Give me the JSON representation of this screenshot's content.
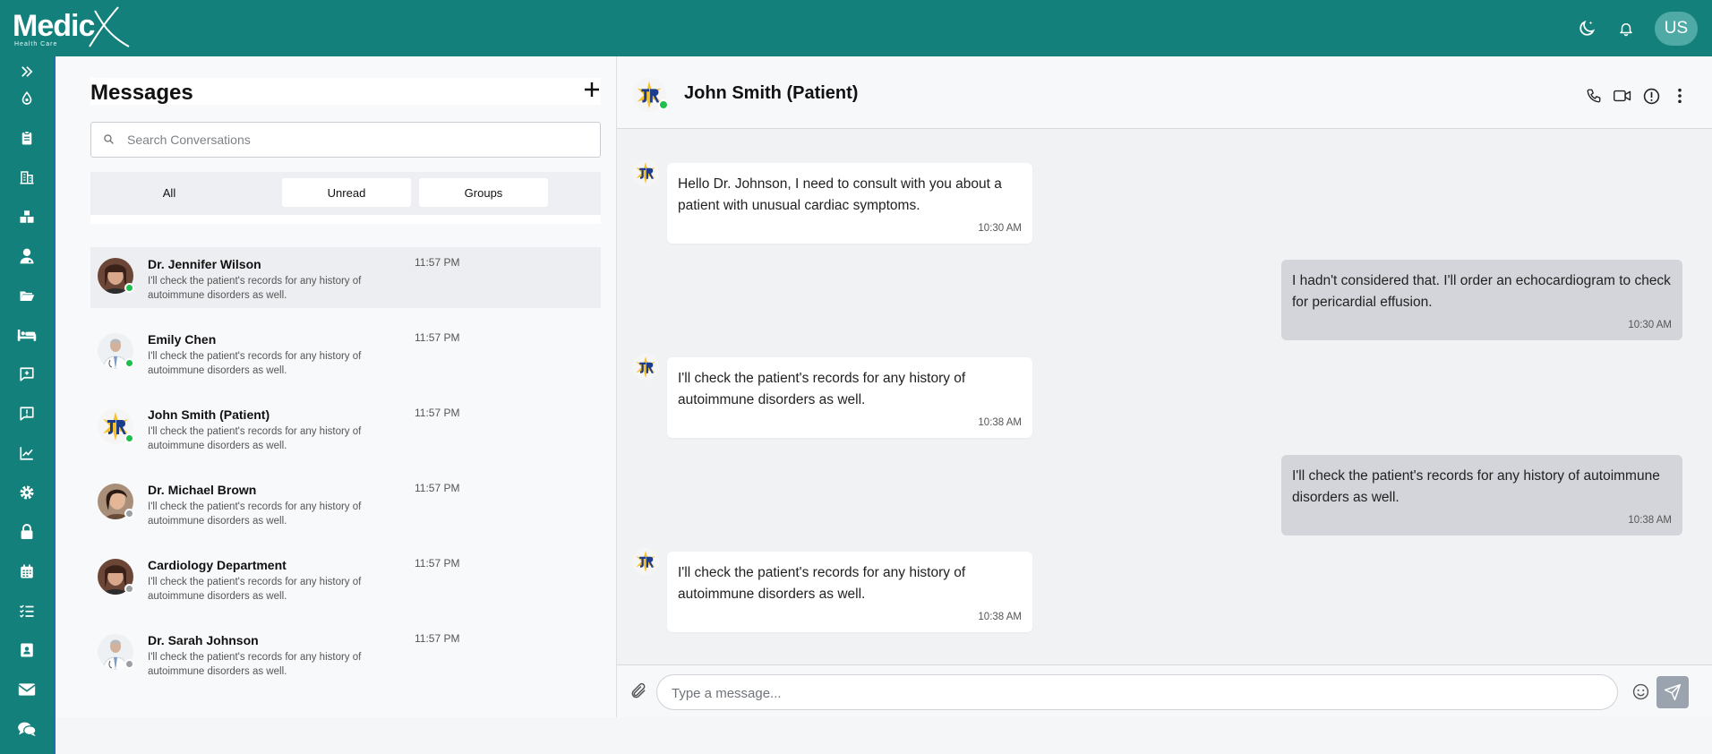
{
  "brand": {
    "name": "MedicX",
    "word": "Medic",
    "tagline": "Health Care"
  },
  "topbar": {
    "user_initials": "US",
    "icons": [
      "theme-toggle-icon",
      "bell-icon"
    ]
  },
  "sidebar": {
    "items": [
      "expand-icon",
      "drop-icon",
      "clipboard-icon",
      "building-icon",
      "boxes-icon",
      "user-doctor-icon",
      "folder-icon",
      "bed-icon",
      "add-message-icon",
      "alert-message-icon",
      "chart-icon",
      "settings-icon",
      "lock-icon",
      "calendar-icon",
      "checklist-icon",
      "contact-icon",
      "mail-icon",
      "comments-icon"
    ]
  },
  "messages_panel": {
    "title": "Messages",
    "search_placeholder": "Search Conversations",
    "filters": [
      "All",
      "Unread",
      "Groups"
    ],
    "active_filter": "All",
    "conversations": [
      {
        "name": "Dr. Jennifer Wilson",
        "time": "11:57 PM",
        "preview": "I'll check the patient's records for any history of autoimmune disorders as well.",
        "online": true,
        "selected": true
      },
      {
        "name": "Emily Chen",
        "time": "11:57 PM",
        "preview": "I'll check the patient's records for any history of autoimmune disorders as well.",
        "online": true,
        "selected": false
      },
      {
        "name": "John Smith (Patient)",
        "time": "11:57 PM",
        "preview": "I'll check the patient's records for any history of autoimmune disorders as well.",
        "online": true,
        "selected": false
      },
      {
        "name": "Dr. Michael Brown",
        "time": "11:57 PM",
        "preview": "I'll check the patient's records for any history of autoimmune disorders as well.",
        "online": false,
        "selected": false
      },
      {
        "name": "Cardiology Department",
        "time": "11:57 PM",
        "preview": "I'll check the patient's records for any history of autoimmune disorders as well.",
        "online": false,
        "selected": false
      },
      {
        "name": "Dr. Sarah Johnson",
        "time": "11:57 PM",
        "preview": "I'll check the patient's records for any history of autoimmune disorders as well.",
        "online": false,
        "selected": false
      }
    ]
  },
  "chat": {
    "contact_name": "John Smith (Patient)",
    "actions": [
      "phone-icon",
      "video-icon",
      "info-icon",
      "more-icon"
    ],
    "messages": [
      {
        "direction": "in",
        "text": "Hello Dr. Johnson, I need to consult with you about a patient with unusual cardiac symptoms.",
        "time": "10:30 AM"
      },
      {
        "direction": "out",
        "text": "I hadn't considered that. I'll order an echocardiogram to check for pericardial effusion.",
        "time": "10:30 AM"
      },
      {
        "direction": "in",
        "text": "I'll check the patient's records for any history of autoimmune disorders as well.",
        "time": "10:38 AM"
      },
      {
        "direction": "out",
        "text": "I'll check the patient's records for any history of autoimmune disorders as well.",
        "time": "10:38 AM"
      },
      {
        "direction": "in",
        "text": "I'll check the patient's records for any history of autoimmune disorders as well.",
        "time": "10:38 AM"
      }
    ],
    "input_placeholder": "Type a message..."
  },
  "colors": {
    "brand": "#13807b",
    "online": "#1fbf4b",
    "offline": "#9aa0a6",
    "outgoing_bubble": "#d3d5da"
  }
}
